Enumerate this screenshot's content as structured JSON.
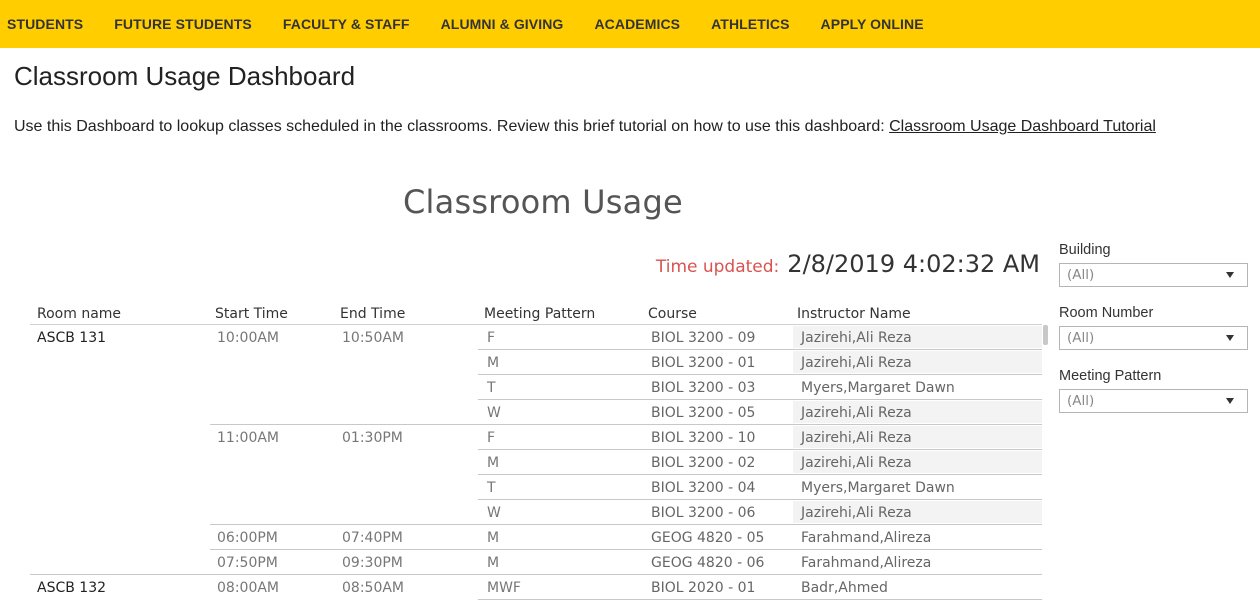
{
  "nav": {
    "items": [
      "STUDENTS",
      "FUTURE STUDENTS",
      "FACULTY & STAFF",
      "ALUMNI & GIVING",
      "ACADEMICS",
      "ATHLETICS",
      "APPLY ONLINE"
    ]
  },
  "page": {
    "title": "Classroom Usage Dashboard",
    "intro_text": "Use this Dashboard to lookup classes scheduled in the classrooms. Review this brief tutorial on how to use this dashboard: ",
    "intro_link": "Classroom Usage Dashboard Tutorial"
  },
  "viz": {
    "title": "Classroom Usage",
    "time_label": "Time updated:",
    "time_value": "2/8/2019 4:02:32 AM"
  },
  "table": {
    "headers": [
      "Room name",
      "Start Time",
      "End Time",
      "Meeting Pattern",
      "Course",
      "Instructor Name"
    ],
    "rooms": [
      "ASCB 131",
      "ASCB 132"
    ],
    "time_groups": [
      {
        "start": "10:00AM",
        "end": "10:50AM"
      },
      {
        "start": "11:00AM",
        "end": "01:30PM"
      },
      {
        "start": "06:00PM",
        "end": "07:40PM"
      },
      {
        "start": "07:50PM",
        "end": "09:30PM"
      },
      {
        "start": "08:00AM",
        "end": "08:50AM"
      }
    ],
    "rows": [
      {
        "pattern": "F",
        "course": "BIOL 3200 - 09",
        "instructor": "Jazirehi,Ali Reza"
      },
      {
        "pattern": "M",
        "course": "BIOL 3200 - 01",
        "instructor": "Jazirehi,Ali Reza"
      },
      {
        "pattern": "T",
        "course": "BIOL 3200 - 03",
        "instructor": "Myers,Margaret Dawn"
      },
      {
        "pattern": "W",
        "course": "BIOL 3200 - 05",
        "instructor": "Jazirehi,Ali Reza"
      },
      {
        "pattern": "F",
        "course": "BIOL 3200 - 10",
        "instructor": "Jazirehi,Ali Reza"
      },
      {
        "pattern": "M",
        "course": "BIOL 3200 - 02",
        "instructor": "Jazirehi,Ali Reza"
      },
      {
        "pattern": "T",
        "course": "BIOL 3200 - 04",
        "instructor": "Myers,Margaret Dawn"
      },
      {
        "pattern": "W",
        "course": "BIOL 3200 - 06",
        "instructor": "Jazirehi,Ali Reza"
      },
      {
        "pattern": "M",
        "course": "GEOG 4820 - 05",
        "instructor": "Farahmand,Alireza"
      },
      {
        "pattern": "M",
        "course": "GEOG 4820 - 06",
        "instructor": "Farahmand,Alireza"
      },
      {
        "pattern": "MWF",
        "course": "BIOL 2020 - 01",
        "instructor": "Badr,Ahmed"
      }
    ]
  },
  "filters": [
    {
      "label": "Building",
      "value": "(All)"
    },
    {
      "label": "Room Number",
      "value": "(All)"
    },
    {
      "label": "Meeting Pattern",
      "value": "(All)"
    }
  ]
}
